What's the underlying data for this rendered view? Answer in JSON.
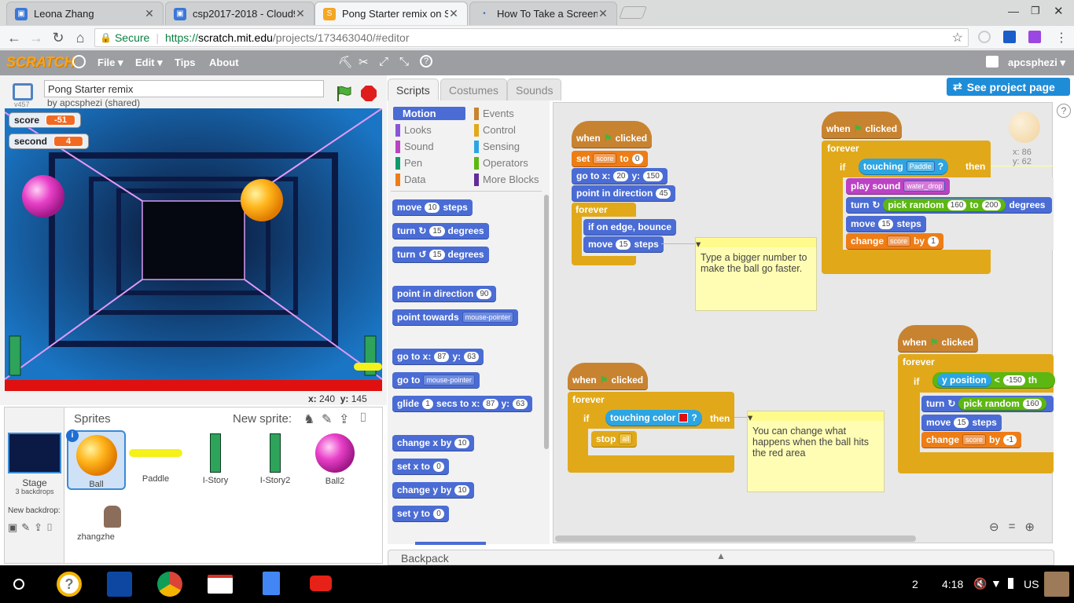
{
  "browser": {
    "tabs": [
      {
        "title": "Leona Zhang",
        "active": false
      },
      {
        "title": "csp2017-2018 - Cloud9",
        "active": false
      },
      {
        "title": "Pong Starter remix on Sc",
        "active": true
      },
      {
        "title": "How To Take a Screensh",
        "active": false
      }
    ],
    "secure_label": "Secure",
    "url_prefix": "https://",
    "url_host": "scratch.mit.edu",
    "url_path": "/projects/173463040/#editor"
  },
  "menubar": {
    "logo": "SCRATCH",
    "items": [
      "File",
      "Edit",
      "Tips",
      "About"
    ],
    "username": "apcsphezi"
  },
  "project": {
    "title": "Pong Starter remix",
    "owner": "by apcsphezi (shared)",
    "version": "v457",
    "see_project_page": "See project page"
  },
  "stage": {
    "monitors": [
      {
        "label": "score",
        "value": "-51"
      },
      {
        "label": "second",
        "value": "4"
      }
    ],
    "mouse_x_label": "x:",
    "mouse_x": "240",
    "mouse_y_label": "y:",
    "mouse_y": "145"
  },
  "sprites": {
    "header": "Sprites",
    "new_sprite_label": "New sprite:",
    "stage_label": "Stage",
    "stage_backdrops": "3 backdrops",
    "new_backdrop_label": "New backdrop:",
    "items": [
      {
        "name": "Ball"
      },
      {
        "name": "Paddle"
      },
      {
        "name": "I-Story"
      },
      {
        "name": "I-Story2"
      },
      {
        "name": "Ball2"
      },
      {
        "name": "zhangzhe"
      }
    ]
  },
  "editor_tabs": [
    "Scripts",
    "Costumes",
    "Sounds"
  ],
  "categories": [
    {
      "name": "Motion",
      "color": "#4a6cd4"
    },
    {
      "name": "Events",
      "color": "#c88330"
    },
    {
      "name": "Looks",
      "color": "#8a55d7"
    },
    {
      "name": "Control",
      "color": "#e1a91a"
    },
    {
      "name": "Sound",
      "color": "#bb42c3"
    },
    {
      "name": "Sensing",
      "color": "#2ca5e2"
    },
    {
      "name": "Pen",
      "color": "#0e9a6c"
    },
    {
      "name": "Operators",
      "color": "#5cb712"
    },
    {
      "name": "Data",
      "color": "#ee7d16"
    },
    {
      "name": "More Blocks",
      "color": "#632d99"
    }
  ],
  "palette": {
    "move": "move",
    "move_n": "10",
    "steps": "steps",
    "turn": "turn",
    "turn_n": "15",
    "degrees": "degrees",
    "point_dir": "point in direction",
    "point_dir_n": "90",
    "point_towards": "point towards",
    "mouse_pointer": "mouse-pointer",
    "goto": "go to x:",
    "goto_x": "87",
    "y": "y:",
    "goto_y": "63",
    "goto2": "go to",
    "glide": "glide",
    "glide_n": "1",
    "secs_to_x": "secs to x:",
    "change_x": "change x by",
    "change_x_n": "10",
    "set_x": "set x to",
    "set_x_n": "0",
    "change_y": "change y by",
    "change_y_n": "10",
    "set_y": "set y to",
    "set_y_n": "0"
  },
  "scripts": {
    "when": "when",
    "clicked": "clicked",
    "set": "set",
    "score": "score",
    "to": "to",
    "zero": "0",
    "goto": "go to x:",
    "s1_x": "20",
    "y": "y:",
    "s1_y": "150",
    "point_dir": "point in direction",
    "s1_dir": "45",
    "forever": "forever",
    "bounce": "if on edge, bounce",
    "move": "move",
    "move_n": "15",
    "steps": "steps",
    "note1": "Type a bigger number to make the ball go faster.",
    "if": "if",
    "touching": "touching",
    "paddle": "Paddle",
    "q": "?",
    "then": "then",
    "play_sound": "play sound",
    "water_drop": "water_drop",
    "turn": "turn",
    "pick_random": "pick random",
    "r160": "160",
    "r200": "200",
    "degrees": "degrees",
    "change": "change",
    "by": "by",
    "one": "1",
    "touching_color": "touching color",
    "stop": "stop",
    "all": "all",
    "note2": "You can change what happens when the ball hits the red area",
    "y_position": "y position",
    "lt": "<",
    "neg150": "-150",
    "th": "th",
    "neg1": "-1",
    "sprite_x": "x: 86",
    "sprite_y": "y: 62"
  },
  "backpack": "Backpack",
  "taskbar": {
    "badge": "2",
    "time": "4:18",
    "locale": "US"
  }
}
